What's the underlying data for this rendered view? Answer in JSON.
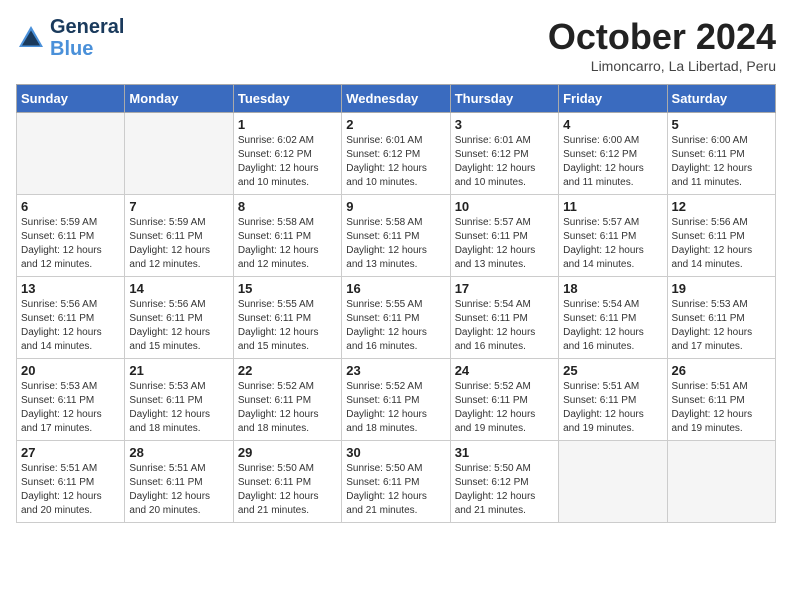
{
  "header": {
    "logo_line1": "General",
    "logo_line2": "Blue",
    "month": "October 2024",
    "location": "Limoncarro, La Libertad, Peru"
  },
  "weekdays": [
    "Sunday",
    "Monday",
    "Tuesday",
    "Wednesday",
    "Thursday",
    "Friday",
    "Saturday"
  ],
  "weeks": [
    [
      {
        "day": "",
        "info": ""
      },
      {
        "day": "",
        "info": ""
      },
      {
        "day": "1",
        "info": "Sunrise: 6:02 AM\nSunset: 6:12 PM\nDaylight: 12 hours and 10 minutes."
      },
      {
        "day": "2",
        "info": "Sunrise: 6:01 AM\nSunset: 6:12 PM\nDaylight: 12 hours and 10 minutes."
      },
      {
        "day": "3",
        "info": "Sunrise: 6:01 AM\nSunset: 6:12 PM\nDaylight: 12 hours and 10 minutes."
      },
      {
        "day": "4",
        "info": "Sunrise: 6:00 AM\nSunset: 6:12 PM\nDaylight: 12 hours and 11 minutes."
      },
      {
        "day": "5",
        "info": "Sunrise: 6:00 AM\nSunset: 6:11 PM\nDaylight: 12 hours and 11 minutes."
      }
    ],
    [
      {
        "day": "6",
        "info": "Sunrise: 5:59 AM\nSunset: 6:11 PM\nDaylight: 12 hours and 12 minutes."
      },
      {
        "day": "7",
        "info": "Sunrise: 5:59 AM\nSunset: 6:11 PM\nDaylight: 12 hours and 12 minutes."
      },
      {
        "day": "8",
        "info": "Sunrise: 5:58 AM\nSunset: 6:11 PM\nDaylight: 12 hours and 12 minutes."
      },
      {
        "day": "9",
        "info": "Sunrise: 5:58 AM\nSunset: 6:11 PM\nDaylight: 12 hours and 13 minutes."
      },
      {
        "day": "10",
        "info": "Sunrise: 5:57 AM\nSunset: 6:11 PM\nDaylight: 12 hours and 13 minutes."
      },
      {
        "day": "11",
        "info": "Sunrise: 5:57 AM\nSunset: 6:11 PM\nDaylight: 12 hours and 14 minutes."
      },
      {
        "day": "12",
        "info": "Sunrise: 5:56 AM\nSunset: 6:11 PM\nDaylight: 12 hours and 14 minutes."
      }
    ],
    [
      {
        "day": "13",
        "info": "Sunrise: 5:56 AM\nSunset: 6:11 PM\nDaylight: 12 hours and 14 minutes."
      },
      {
        "day": "14",
        "info": "Sunrise: 5:56 AM\nSunset: 6:11 PM\nDaylight: 12 hours and 15 minutes."
      },
      {
        "day": "15",
        "info": "Sunrise: 5:55 AM\nSunset: 6:11 PM\nDaylight: 12 hours and 15 minutes."
      },
      {
        "day": "16",
        "info": "Sunrise: 5:55 AM\nSunset: 6:11 PM\nDaylight: 12 hours and 16 minutes."
      },
      {
        "day": "17",
        "info": "Sunrise: 5:54 AM\nSunset: 6:11 PM\nDaylight: 12 hours and 16 minutes."
      },
      {
        "day": "18",
        "info": "Sunrise: 5:54 AM\nSunset: 6:11 PM\nDaylight: 12 hours and 16 minutes."
      },
      {
        "day": "19",
        "info": "Sunrise: 5:53 AM\nSunset: 6:11 PM\nDaylight: 12 hours and 17 minutes."
      }
    ],
    [
      {
        "day": "20",
        "info": "Sunrise: 5:53 AM\nSunset: 6:11 PM\nDaylight: 12 hours and 17 minutes."
      },
      {
        "day": "21",
        "info": "Sunrise: 5:53 AM\nSunset: 6:11 PM\nDaylight: 12 hours and 18 minutes."
      },
      {
        "day": "22",
        "info": "Sunrise: 5:52 AM\nSunset: 6:11 PM\nDaylight: 12 hours and 18 minutes."
      },
      {
        "day": "23",
        "info": "Sunrise: 5:52 AM\nSunset: 6:11 PM\nDaylight: 12 hours and 18 minutes."
      },
      {
        "day": "24",
        "info": "Sunrise: 5:52 AM\nSunset: 6:11 PM\nDaylight: 12 hours and 19 minutes."
      },
      {
        "day": "25",
        "info": "Sunrise: 5:51 AM\nSunset: 6:11 PM\nDaylight: 12 hours and 19 minutes."
      },
      {
        "day": "26",
        "info": "Sunrise: 5:51 AM\nSunset: 6:11 PM\nDaylight: 12 hours and 19 minutes."
      }
    ],
    [
      {
        "day": "27",
        "info": "Sunrise: 5:51 AM\nSunset: 6:11 PM\nDaylight: 12 hours and 20 minutes."
      },
      {
        "day": "28",
        "info": "Sunrise: 5:51 AM\nSunset: 6:11 PM\nDaylight: 12 hours and 20 minutes."
      },
      {
        "day": "29",
        "info": "Sunrise: 5:50 AM\nSunset: 6:11 PM\nDaylight: 12 hours and 21 minutes."
      },
      {
        "day": "30",
        "info": "Sunrise: 5:50 AM\nSunset: 6:11 PM\nDaylight: 12 hours and 21 minutes."
      },
      {
        "day": "31",
        "info": "Sunrise: 5:50 AM\nSunset: 6:12 PM\nDaylight: 12 hours and 21 minutes."
      },
      {
        "day": "",
        "info": ""
      },
      {
        "day": "",
        "info": ""
      }
    ]
  ]
}
